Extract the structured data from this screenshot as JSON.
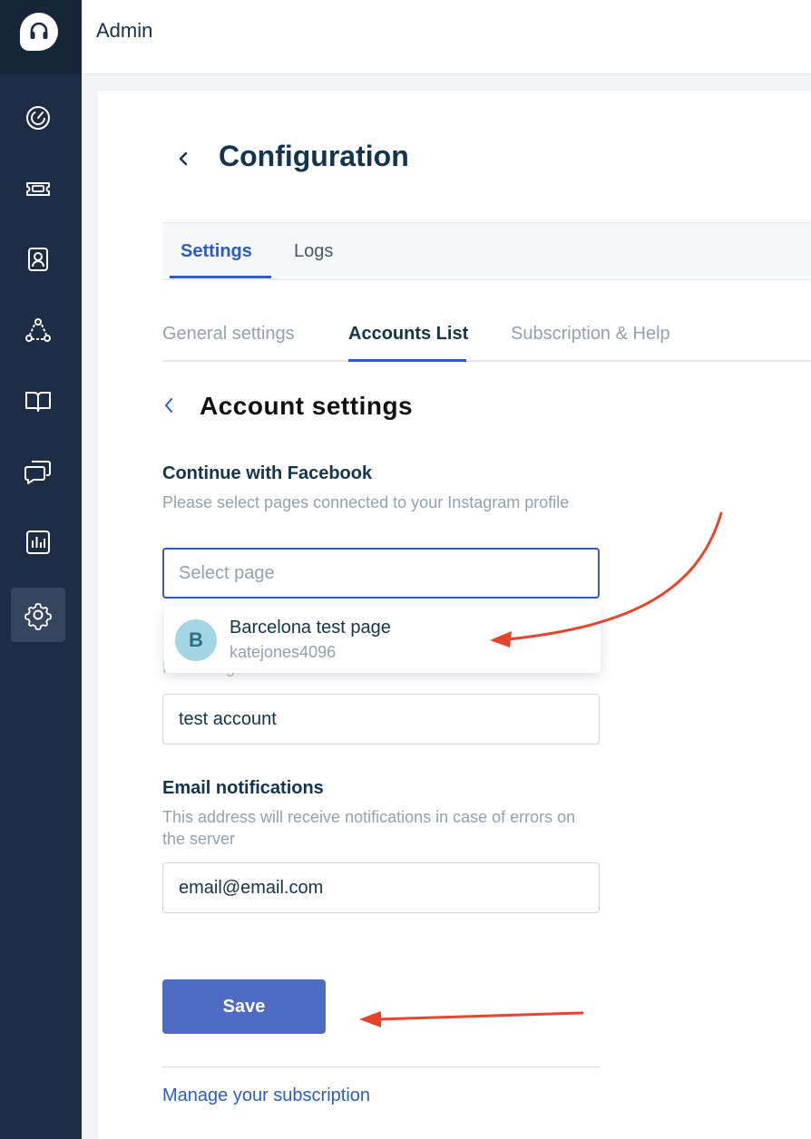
{
  "app": {
    "title": "Admin"
  },
  "sidebar": {
    "items": [
      {
        "name": "dashboard",
        "icon": "gauge-icon"
      },
      {
        "name": "tickets",
        "icon": "ticket-icon"
      },
      {
        "name": "contacts",
        "icon": "contact-card-icon"
      },
      {
        "name": "groups",
        "icon": "network-icon"
      },
      {
        "name": "knowledge-base",
        "icon": "book-icon"
      },
      {
        "name": "conversations",
        "icon": "chat-bubbles-icon"
      },
      {
        "name": "reports",
        "icon": "bar-chart-icon"
      },
      {
        "name": "settings",
        "icon": "gear-icon",
        "active": true
      }
    ]
  },
  "page": {
    "title": "Configuration"
  },
  "tabs": {
    "settings": "Settings",
    "logs": "Logs"
  },
  "subtabs": {
    "general": "General settings",
    "accounts": "Accounts List",
    "subscription": "Subscription & Help"
  },
  "account": {
    "title": "Account settings",
    "facebook": {
      "label": "Continue with Facebook",
      "help": "Please select pages connected to your Instagram profile",
      "placeholder": "Select page"
    },
    "dropdown": {
      "avatar_letter": "B",
      "page_name": "Barcelona test page",
      "page_user": "katejones4096"
    },
    "name_field": {
      "help": "How integration will be named on the account list",
      "value": "test account"
    },
    "email": {
      "label": "Email notifications",
      "help": "This address will receive notifications in case of errors on the server",
      "value": "email@email.com"
    },
    "save_label": "Save",
    "manage_link": "Manage your subscription"
  },
  "colors": {
    "sidebar": "#1c2d45",
    "accent": "#2c5cc5",
    "save_button": "#4e6bc4",
    "annotation_arrow": "#e4452b"
  }
}
